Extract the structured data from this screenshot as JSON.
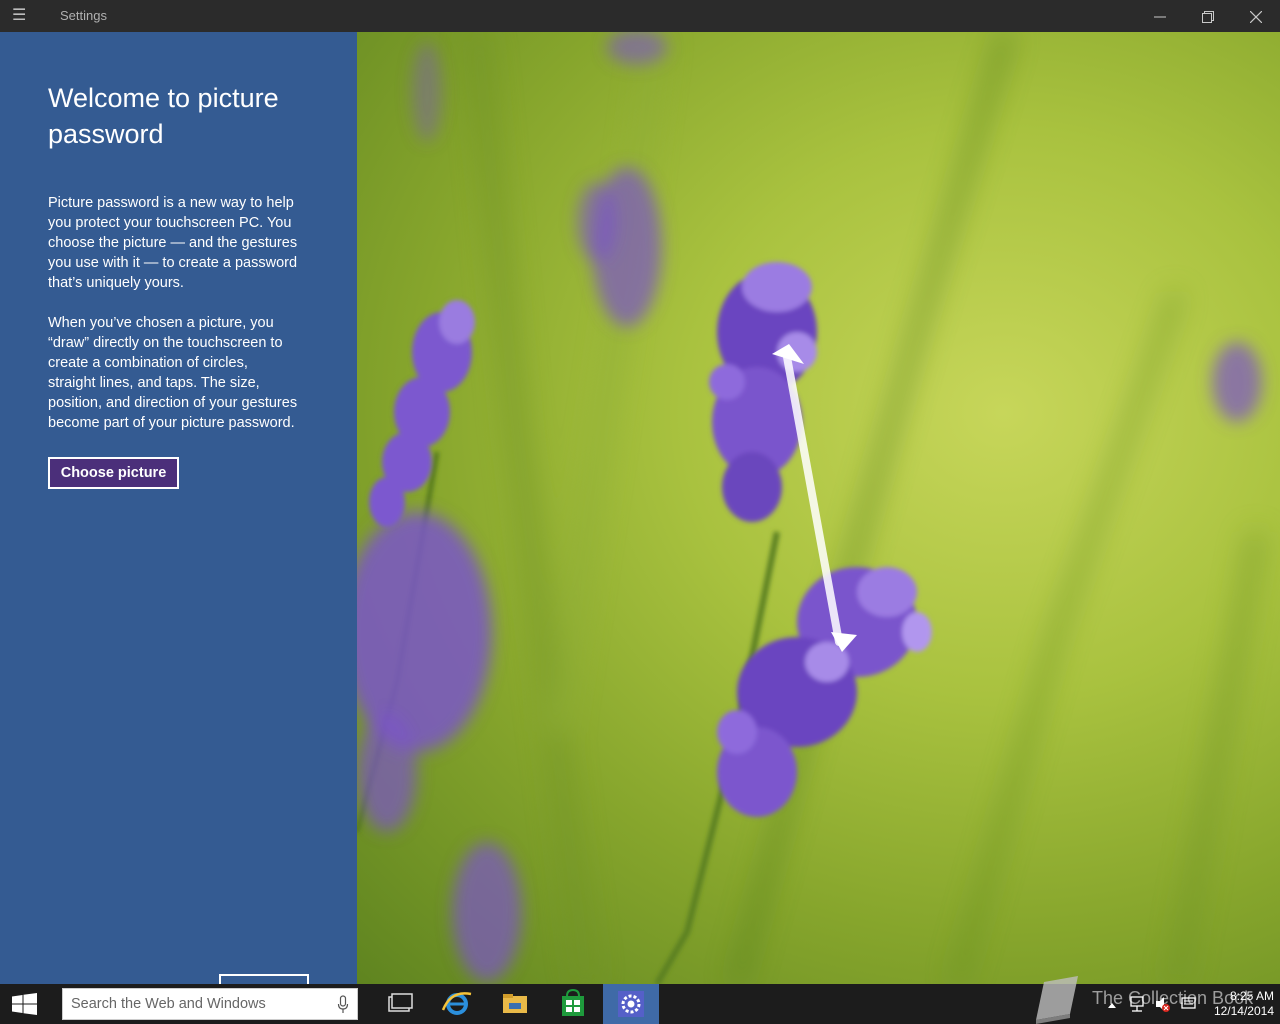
{
  "window": {
    "title": "Settings"
  },
  "panel": {
    "heading": "Welcome to picture password",
    "paragraph1": "Picture password is a new way to help you protect your touchscreen PC. You choose the picture — and the gestures you use with it — to create a password that’s uniquely yours.",
    "paragraph2": "When you’ve chosen a picture, you “draw” directly on the touchscreen to create a combination of circles, straight lines, and taps. The size, position, and direction of your gestures become part of your picture password.",
    "choose_button": "Choose picture"
  },
  "taskbar": {
    "search_placeholder": "Search the Web and Windows",
    "apps": [
      "task-view",
      "internet-explorer",
      "file-explorer",
      "store",
      "settings"
    ],
    "active_app": "settings",
    "clock_time": "8:25 AM",
    "clock_date": "12/14/2014"
  },
  "watermark": {
    "text": "The Collection Book"
  },
  "colors": {
    "panel": "#345b92",
    "button_fill": "#4b2f7a",
    "titlebar": "#2b2b2b",
    "taskbar": "#1c1c1c",
    "active_app": "#3f6aa7"
  }
}
